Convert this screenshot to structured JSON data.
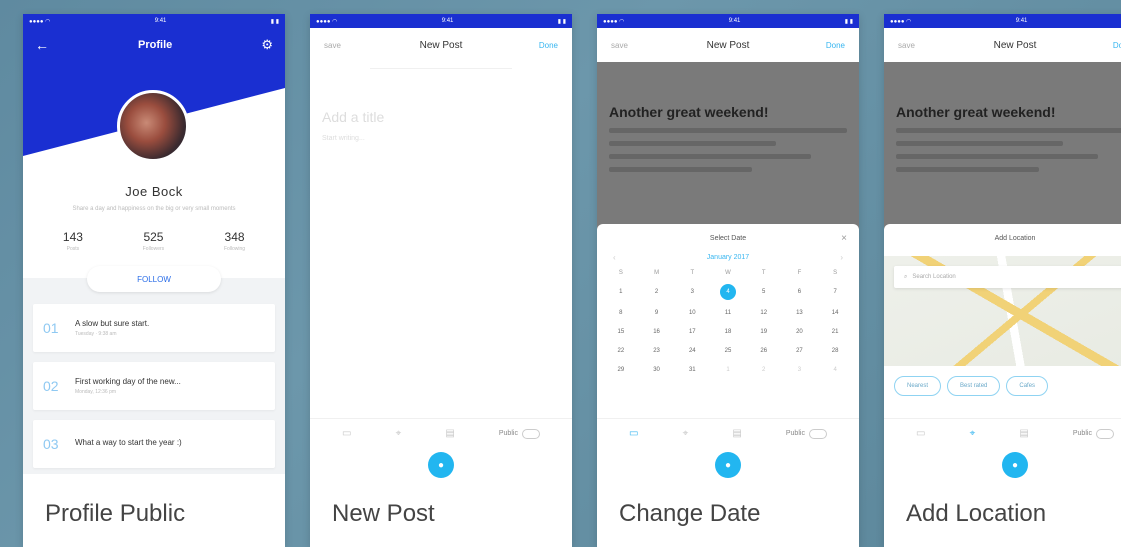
{
  "phones": {
    "profile": {
      "caption": "Profile Public",
      "title": "Profile",
      "name": "Joe Bock",
      "bio": "Share a day and happiness on the big or very small moments",
      "stats": [
        {
          "num": "143",
          "label": "Posts"
        },
        {
          "num": "525",
          "label": "Followers"
        },
        {
          "num": "348",
          "label": "Following"
        }
      ],
      "follow_label": "FOLLOW",
      "posts": [
        {
          "index": "01",
          "title": "A slow but sure start.",
          "date": "Tuesday · 9:38 am"
        },
        {
          "index": "02",
          "title": "First working day of the new...",
          "date": "Monday, 12:36 pm"
        },
        {
          "index": "03",
          "title": "What a way to start the year :)",
          "date": ""
        }
      ]
    },
    "new_post": {
      "caption": "New Post",
      "nav_left": "save",
      "nav_title": "New Post",
      "nav_right": "Done",
      "title_placeholder": "Add a title",
      "body_placeholder": "Start writing...",
      "public_label": "Public"
    },
    "change_date": {
      "caption": "Change Date",
      "nav_left": "save",
      "nav_title": "New Post",
      "nav_right": "Done",
      "post_title": "Another great weekend!",
      "sheet_title": "Select Date",
      "month": "January 2017",
      "dow": [
        "S",
        "M",
        "T",
        "W",
        "T",
        "F",
        "S"
      ],
      "days": [
        "1",
        "2",
        "3",
        "4",
        "5",
        "6",
        "7",
        "8",
        "9",
        "10",
        "11",
        "12",
        "13",
        "14",
        "15",
        "16",
        "17",
        "18",
        "19",
        "20",
        "21",
        "22",
        "23",
        "24",
        "25",
        "26",
        "27",
        "28",
        "29",
        "30",
        "31",
        "1",
        "2",
        "3",
        "4"
      ],
      "selected_day": "4",
      "public_label": "Public"
    },
    "add_location": {
      "caption": "Add Location",
      "nav_left": "save",
      "nav_title": "New Post",
      "nav_right": "Done",
      "post_title": "Another great weekend!",
      "sheet_title": "Add Location",
      "search_placeholder": "Search Location",
      "chips": [
        "Nearest",
        "Best rated",
        "Cafes"
      ],
      "public_label": "Public"
    }
  },
  "colors": {
    "primary": "#1a2fd1",
    "accent": "#22b6f0"
  }
}
